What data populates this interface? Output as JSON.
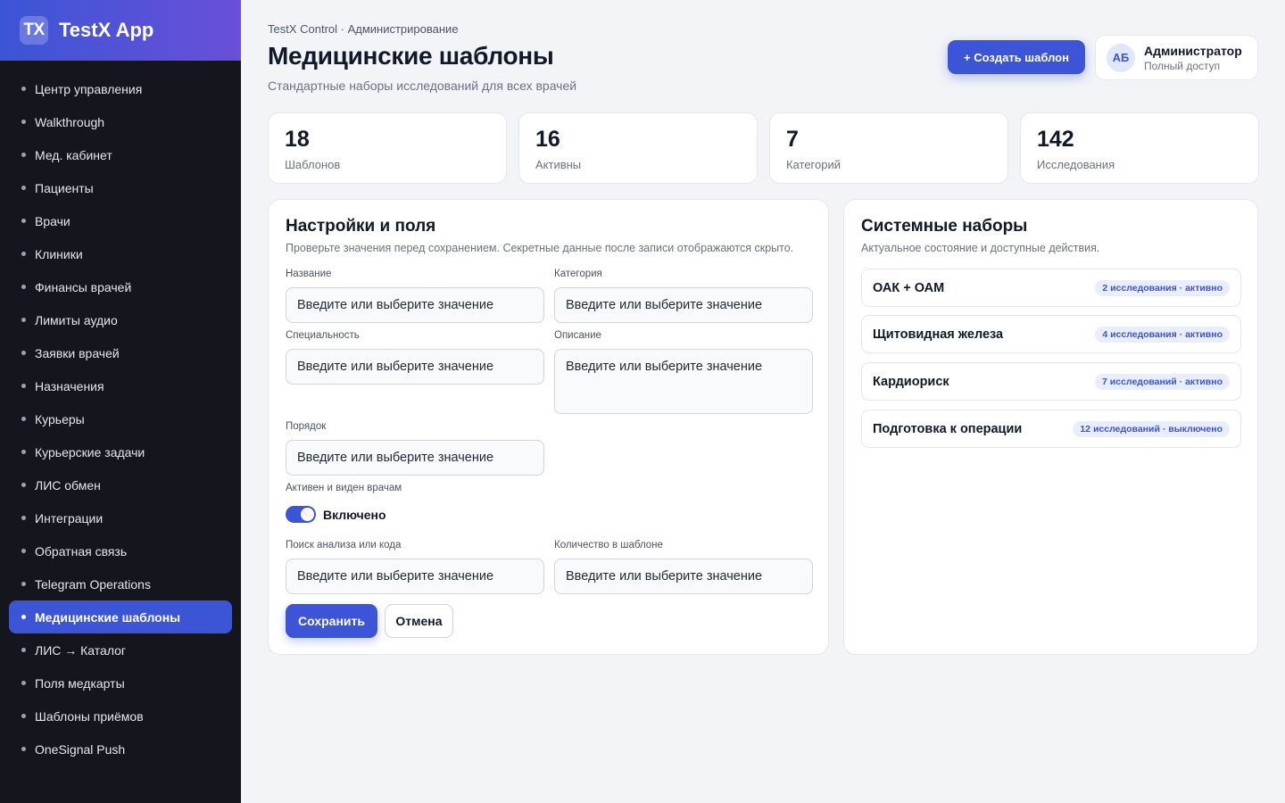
{
  "app": {
    "logo": "TX",
    "name": "TestX App"
  },
  "sidebar": {
    "items": [
      {
        "label": "Центр управления",
        "active": false
      },
      {
        "label": "Walkthrough",
        "active": false
      },
      {
        "label": "Мед. кабинет",
        "active": false
      },
      {
        "label": "Пациенты",
        "active": false
      },
      {
        "label": "Врачи",
        "active": false
      },
      {
        "label": "Клиники",
        "active": false
      },
      {
        "label": "Финансы врачей",
        "active": false
      },
      {
        "label": "Лимиты аудио",
        "active": false
      },
      {
        "label": "Заявки врачей",
        "active": false
      },
      {
        "label": "Назначения",
        "active": false
      },
      {
        "label": "Курьеры",
        "active": false
      },
      {
        "label": "Курьерские задачи",
        "active": false
      },
      {
        "label": "ЛИС обмен",
        "active": false
      },
      {
        "label": "Интеграции",
        "active": false
      },
      {
        "label": "Обратная связь",
        "active": false
      },
      {
        "label": "Telegram Operations",
        "active": false
      },
      {
        "label": "Медицинские шаблоны",
        "active": true
      },
      {
        "label": "ЛИС → Каталог",
        "active": false
      },
      {
        "label": "Поля медкарты",
        "active": false
      },
      {
        "label": "Шаблоны приёмов",
        "active": false
      },
      {
        "label": "OneSignal Push",
        "active": false
      }
    ]
  },
  "header": {
    "breadcrumb": "TestX Control · Администрирование",
    "title": "Медицинские шаблоны",
    "subtitle": "Стандартные наборы исследований для всех врачей",
    "create_button": "+ Создать шаблон"
  },
  "user": {
    "initials": "АБ",
    "name": "Администратор",
    "role": "Полный доступ"
  },
  "stats": [
    {
      "value": "18",
      "label": "Шаблонов"
    },
    {
      "value": "16",
      "label": "Активны"
    },
    {
      "value": "7",
      "label": "Категорий"
    },
    {
      "value": "142",
      "label": "Исследования"
    }
  ],
  "form": {
    "title": "Настройки и поля",
    "description": "Проверьте значения перед сохранением. Секретные данные после записи отображаются скрыто.",
    "fields": {
      "name": {
        "label": "Название",
        "placeholder": "Введите или выберите значение"
      },
      "category": {
        "label": "Категория",
        "placeholder": "Введите или выберите значение"
      },
      "specialty": {
        "label": "Специальность",
        "placeholder": "Введите или выберите значение"
      },
      "description": {
        "label": "Описание",
        "placeholder": "Введите или выберите значение"
      },
      "order": {
        "label": "Порядок",
        "placeholder": "Введите или выберите значение"
      },
      "search": {
        "label": "Поиск анализа или кода",
        "placeholder": "Введите или выберите значение"
      },
      "quantity": {
        "label": "Количество в шаблоне",
        "placeholder": "Введите или выберите значение"
      }
    },
    "toggle": {
      "label": "Активен и виден врачам",
      "state_text": "Включено",
      "on": true
    },
    "save_button": "Сохранить",
    "cancel_button": "Отмена"
  },
  "system_sets": {
    "title": "Системные наборы",
    "description": "Актуальное состояние и доступные действия.",
    "items": [
      {
        "name": "ОАК + ОАМ",
        "badge": "2 исследования · активно"
      },
      {
        "name": "Щитовидная железа",
        "badge": "4 исследования · активно"
      },
      {
        "name": "Кардиориск",
        "badge": "7 исследований · активно"
      },
      {
        "name": "Подготовка к операции",
        "badge": "12 исследований · выключено"
      }
    ]
  },
  "colors": {
    "accent": "#3b55d6",
    "sidebar_bg": "#14151d",
    "page_bg": "#f3f4f8"
  }
}
